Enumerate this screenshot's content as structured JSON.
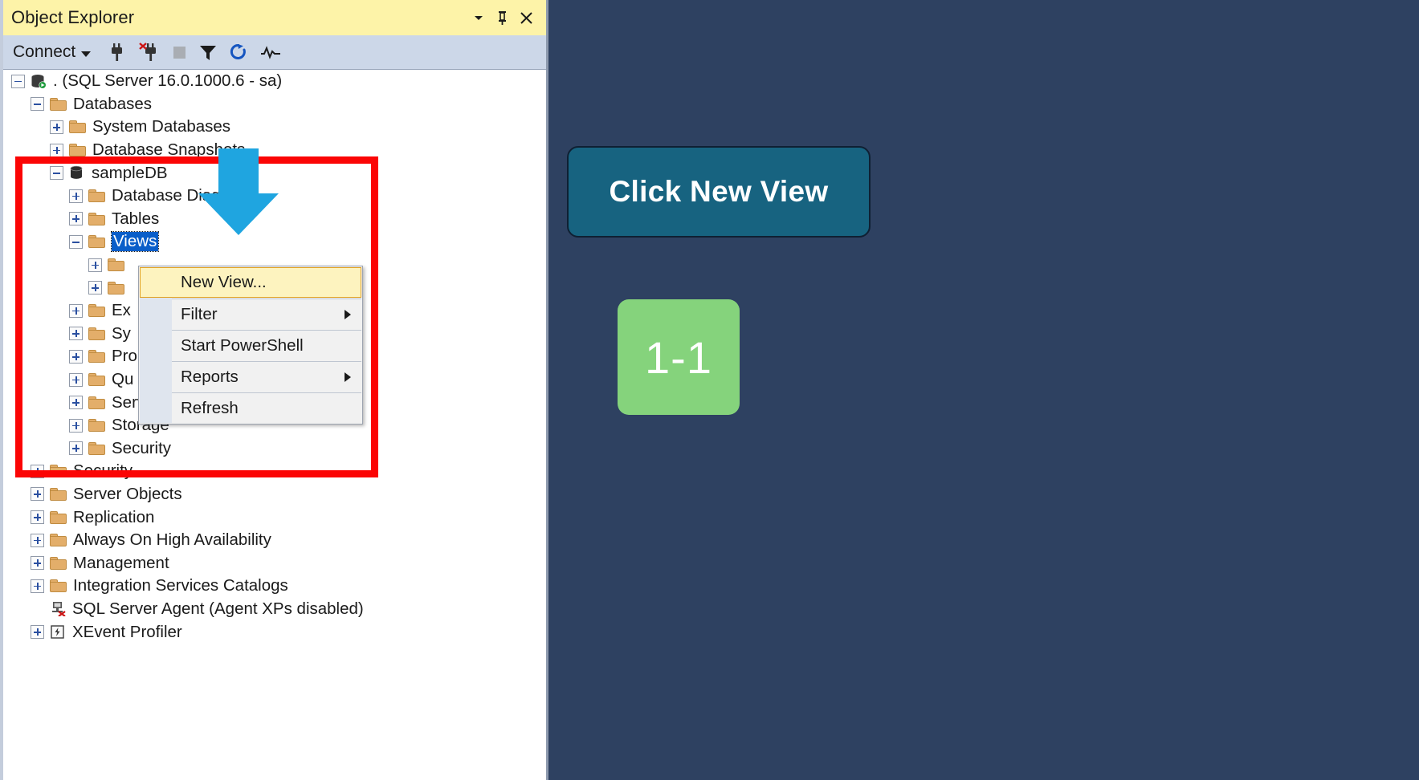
{
  "panel": {
    "title": "Object Explorer",
    "title_actions": [
      {
        "name": "window-dropdown-icon",
        "glyph": "▾"
      },
      {
        "name": "pin-icon",
        "glyph": "⇅"
      },
      {
        "name": "close-icon",
        "glyph": "✕"
      }
    ],
    "toolbar": {
      "connect_label": "Connect",
      "icons": [
        {
          "name": "connect-object-explorer-icon"
        },
        {
          "name": "disconnect-icon"
        },
        {
          "name": "stop-icon"
        },
        {
          "name": "filter-icon"
        },
        {
          "name": "refresh-icon"
        },
        {
          "name": "activity-monitor-icon"
        }
      ]
    }
  },
  "tree": [
    {
      "id": "server",
      "level": 0,
      "expander": "minus",
      "icon": "server",
      "label": ". (SQL Server 16.0.1000.6 - sa)"
    },
    {
      "id": "databases",
      "level": 1,
      "expander": "minus",
      "icon": "folder",
      "label": "Databases"
    },
    {
      "id": "system-databases",
      "level": 2,
      "expander": "plus",
      "icon": "folder",
      "label": "System Databases"
    },
    {
      "id": "database-snapshots",
      "level": 2,
      "expander": "plus",
      "icon": "folder",
      "label": "Database Snapshots"
    },
    {
      "id": "sampledb",
      "level": 2,
      "expander": "minus",
      "icon": "database",
      "label": "sampleDB"
    },
    {
      "id": "database-diagrams",
      "level": 3,
      "expander": "plus",
      "icon": "folder",
      "label": "Database Diagrams"
    },
    {
      "id": "tables",
      "level": 3,
      "expander": "plus",
      "icon": "folder",
      "label": "Tables"
    },
    {
      "id": "views",
      "level": 3,
      "expander": "minus",
      "icon": "folder",
      "label": "Views",
      "selected": true
    },
    {
      "id": "views-child-1",
      "level": 4,
      "expander": "plus",
      "icon": "folder",
      "label": ""
    },
    {
      "id": "views-child-2",
      "level": 4,
      "expander": "plus",
      "icon": "folder",
      "label": ""
    },
    {
      "id": "external-resources",
      "level": 3,
      "expander": "plus",
      "icon": "folder",
      "label": "Ex"
    },
    {
      "id": "synonyms",
      "level": 3,
      "expander": "plus",
      "icon": "folder",
      "label": "Sy"
    },
    {
      "id": "programmability",
      "level": 3,
      "expander": "plus",
      "icon": "folder",
      "label": "Pro"
    },
    {
      "id": "query-store",
      "level": 3,
      "expander": "plus",
      "icon": "folder",
      "label": "Qu"
    },
    {
      "id": "service-broker",
      "level": 3,
      "expander": "plus",
      "icon": "folder",
      "label": "Service Broker"
    },
    {
      "id": "storage",
      "level": 3,
      "expander": "plus",
      "icon": "folder",
      "label": "Storage"
    },
    {
      "id": "db-security",
      "level": 3,
      "expander": "plus",
      "icon": "folder",
      "label": "Security"
    },
    {
      "id": "server-security",
      "level": 1,
      "expander": "plus",
      "icon": "folder",
      "label": "Security"
    },
    {
      "id": "server-objects",
      "level": 1,
      "expander": "plus",
      "icon": "folder",
      "label": "Server Objects"
    },
    {
      "id": "replication",
      "level": 1,
      "expander": "plus",
      "icon": "folder",
      "label": "Replication"
    },
    {
      "id": "always-on",
      "level": 1,
      "expander": "plus",
      "icon": "folder",
      "label": "Always On High Availability"
    },
    {
      "id": "management",
      "level": 1,
      "expander": "plus",
      "icon": "folder",
      "label": "Management"
    },
    {
      "id": "integration-svcs",
      "level": 1,
      "expander": "plus",
      "icon": "folder",
      "label": "Integration Services Catalogs"
    },
    {
      "id": "sql-server-agent",
      "level": 1,
      "expander": "none",
      "icon": "agent",
      "label": "SQL Server Agent (Agent XPs disabled)"
    },
    {
      "id": "xevent-profiler",
      "level": 1,
      "expander": "plus",
      "icon": "xevent",
      "label": "XEvent Profiler"
    }
  ],
  "context_menu": {
    "items": [
      {
        "label": "New View...",
        "highlighted": true,
        "submenu": false,
        "separator_after": true
      },
      {
        "label": "Filter",
        "highlighted": false,
        "submenu": true,
        "separator_after": true
      },
      {
        "label": "Start PowerShell",
        "highlighted": false,
        "submenu": false,
        "separator_after": true
      },
      {
        "label": "Reports",
        "highlighted": false,
        "submenu": true,
        "separator_after": true
      },
      {
        "label": "Refresh",
        "highlighted": false,
        "submenu": false,
        "separator_after": false
      }
    ]
  },
  "annotations": {
    "callout_text": "Click New View",
    "step_badge_text": "1-1",
    "colors": {
      "callout_bg": "#176380",
      "step_badge_bg": "#85d37c",
      "highlight_rect": "#fb0505",
      "arrow": "#1fa5e0",
      "canvas_bg": "#2e4161"
    }
  }
}
